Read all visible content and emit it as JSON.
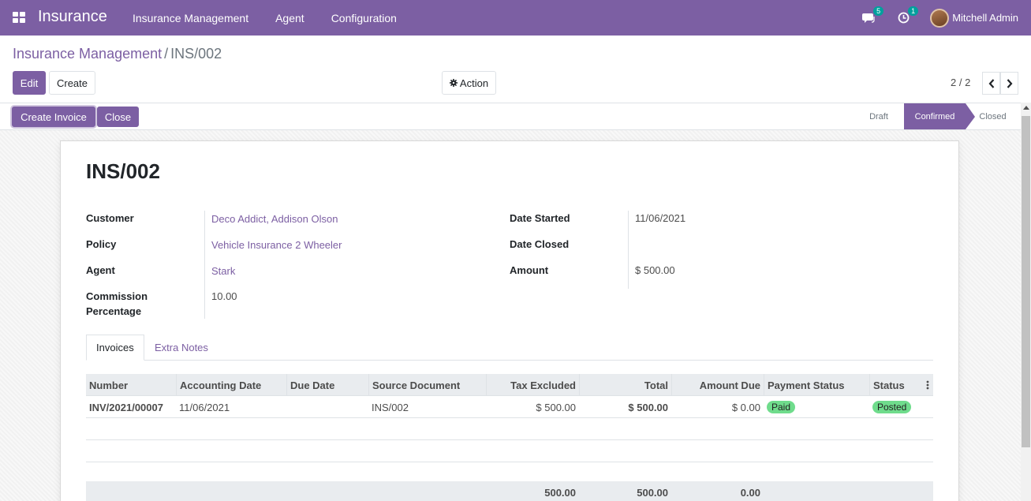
{
  "navbar": {
    "app_name": "Insurance",
    "menu": [
      "Insurance Management",
      "Agent",
      "Configuration"
    ],
    "messages_badge": "5",
    "activities_badge": "1",
    "user_name": "Mitchell Admin"
  },
  "breadcrumb": {
    "parent": "Insurance Management",
    "separator": "/",
    "current": "INS/002"
  },
  "buttons": {
    "edit": "Edit",
    "create": "Create",
    "action": "Action",
    "create_invoice": "Create Invoice",
    "close": "Close"
  },
  "pager": {
    "value": "2 / 2"
  },
  "statusbar": {
    "steps": [
      "Draft",
      "Confirmed",
      "Closed"
    ],
    "active": "Confirmed"
  },
  "record": {
    "title": "INS/002",
    "left_fields": [
      {
        "label": "Customer",
        "value": "Deco Addict, Addison Olson"
      },
      {
        "label": "Policy",
        "value": "Vehicle Insurance 2 Wheeler"
      },
      {
        "label": "Agent",
        "value": "Stark"
      },
      {
        "label": "Commission Percentage",
        "value": "10.00"
      }
    ],
    "right_fields": [
      {
        "label": "Date Started",
        "value": "11/06/2021"
      },
      {
        "label": "Date Closed",
        "value": ""
      },
      {
        "label": "Amount",
        "value": "$ 500.00"
      }
    ],
    "commission_label_line1": "Commission",
    "commission_label_line2": "Percentage"
  },
  "tabs": [
    "Invoices",
    "Extra Notes"
  ],
  "invoices": {
    "columns": [
      "Number",
      "Accounting Date",
      "Due Date",
      "Source Document",
      "Tax Excluded",
      "Total",
      "Amount Due",
      "Payment Status",
      "Status"
    ],
    "rows": [
      {
        "number": "INV/2021/00007",
        "accounting_date": "11/06/2021",
        "due_date": "",
        "source_document": "INS/002",
        "tax_excluded": "$ 500.00",
        "total": "$ 500.00",
        "amount_due": "$ 0.00",
        "payment_status": "Paid",
        "status": "Posted"
      }
    ],
    "totals": {
      "tax_excluded": "500.00",
      "total": "500.00",
      "amount_due": "0.00"
    }
  },
  "colors": {
    "brand": "#7c5fa3",
    "badge": "#00a09d",
    "pill_green": "#6fdc8c"
  }
}
